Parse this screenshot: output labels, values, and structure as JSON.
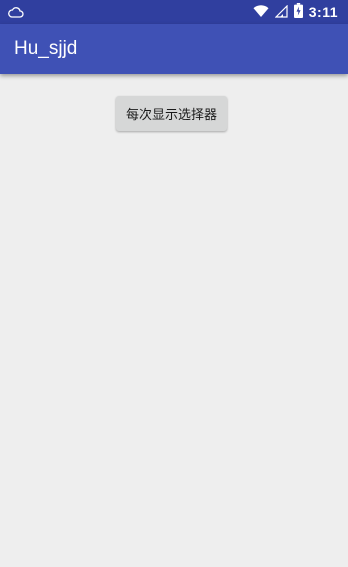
{
  "status_bar": {
    "time": "3:11",
    "icons": [
      "cloud-icon",
      "wifi-icon",
      "signal-icon",
      "battery-icon"
    ]
  },
  "app_bar": {
    "title": "Hu_sjjd"
  },
  "main": {
    "picker_button_label": "每次显示选择器"
  },
  "colors": {
    "status_bar": "#303f9f",
    "app_bar": "#3f51b5",
    "background": "#eeeeee",
    "button": "#d6d7d7"
  }
}
